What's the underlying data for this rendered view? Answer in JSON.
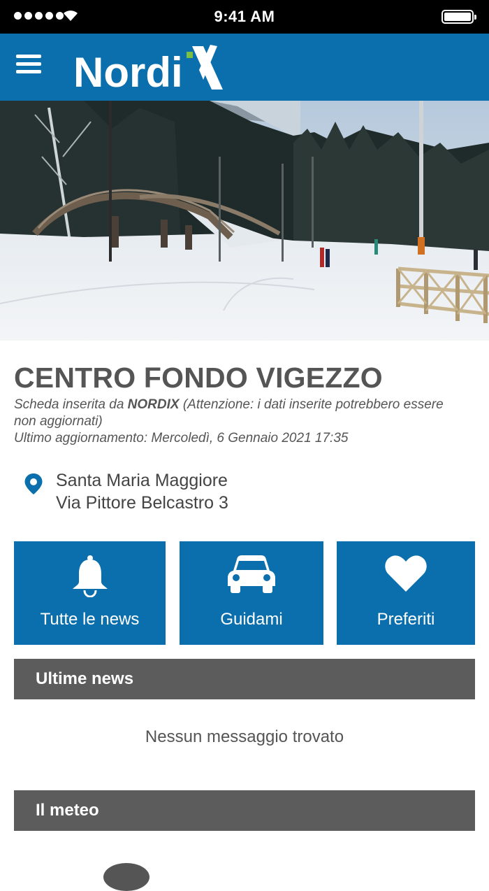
{
  "status_bar": {
    "time": "9:41 AM"
  },
  "header": {
    "logo_text": "NordiX",
    "brand_color": "#0a6fac"
  },
  "center": {
    "name": "CENTRO FONDO VIGEZZO",
    "added_by_prefix": "Scheda inserita da ",
    "added_by": "NORDIX",
    "added_by_note": " (Attenzione: i dati inserite potrebbero essere non aggiornati)",
    "last_update": "Ultimo aggiornamento: Mercoledì, 6 Gennaio 2021 17:35",
    "city": "Santa Maria Maggiore",
    "street": "Via Pittore Belcastro 3"
  },
  "actions": [
    {
      "label": "Tutte le news",
      "icon": "bell-icon"
    },
    {
      "label": "Guidami",
      "icon": "car-icon"
    },
    {
      "label": "Preferiti",
      "icon": "heart-icon"
    }
  ],
  "news": {
    "title": "Ultime news",
    "empty": "Nessun messaggio trovato"
  },
  "meteo": {
    "title": "Il meteo"
  },
  "colors": {
    "section_header": "#5c5c5c",
    "text": "#555555"
  }
}
